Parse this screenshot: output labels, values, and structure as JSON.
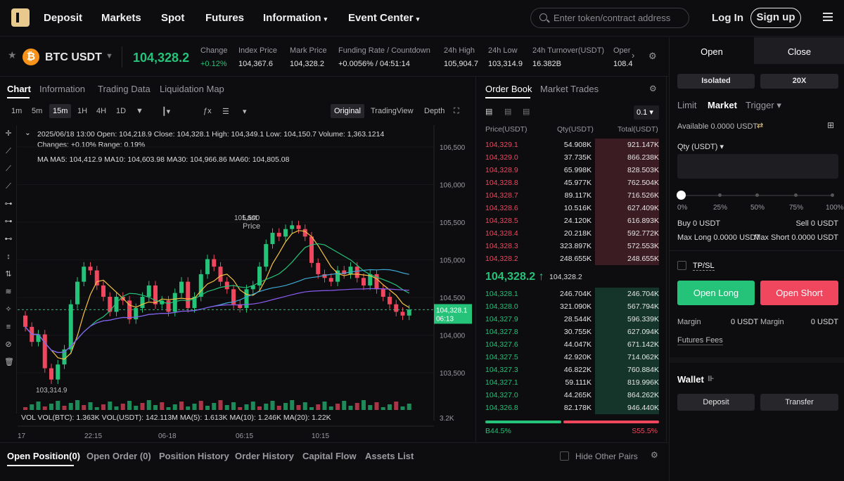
{
  "nav": {
    "items": [
      "Deposit",
      "Markets",
      "Spot",
      "Futures",
      "Information",
      "Event Center"
    ],
    "search_placeholder": "Enter token/contract address",
    "login": "Log In",
    "signup": "Sign up"
  },
  "ticker": {
    "pair": "BTC USDT",
    "last_price": "104,328.2",
    "stats": [
      {
        "label": "Change",
        "value": "+0.12%"
      },
      {
        "label": "Index Price",
        "value": "104,367.6"
      },
      {
        "label": "Mark Price",
        "value": "104,328.2"
      },
      {
        "label": "Funding Rate / Countdown",
        "value": "+0.0056% / 04:51:14"
      },
      {
        "label": "24h High",
        "value": "105,904.7"
      },
      {
        "label": "24h Low",
        "value": "103,314.9"
      },
      {
        "label": "24h Turnover(USDT)",
        "value": "16.382B"
      },
      {
        "label": "Oper",
        "value": "108.4"
      }
    ]
  },
  "chart_tabs": [
    "Chart",
    "Information",
    "Trading Data",
    "Liquidation Map"
  ],
  "chart_toolbar": {
    "intervals": [
      "1m",
      "5m",
      "15m",
      "1H",
      "4H",
      "1D"
    ],
    "price_type": "Last Price",
    "views": [
      "Original",
      "TradingView",
      "Depth"
    ]
  },
  "candle_info": {
    "line1": "2025/06/18 13:00  Open: 104,218.9  Close: 104,328.1  High: 104,349.1  Low: 104,150.7  Volume: 1,363.1214",
    "line2": "Changes: +0.10%  Range: 0.19%",
    "ma_line": "MA  MA5: 104,412.9  MA10: 104,603.98  MA30: 104,966.86  MA60: 104,805.08",
    "vol_line": "VOL  VOL(BTC): 1.363K  VOL(USDT): 142.113M  MA(5): 1.613K  MA(10): 1.246K  MA(20): 1.22K"
  },
  "chart_data": {
    "type": "line",
    "y_ticks": [
      "106,500",
      "106,000",
      "105,500",
      "105,000",
      "104,500",
      "104,000",
      "103,500"
    ],
    "x_ticks": [
      "17",
      "22:15",
      "06-18",
      "06:15",
      "10:15"
    ],
    "annotations": {
      "high": "105,500",
      "low": "103,314.9",
      "current": "104,328.1",
      "countdown": "06:13",
      "vol_axis": "3.2K"
    },
    "close": [
      104100,
      103900,
      104000,
      103550,
      103400,
      103600,
      103800,
      104400,
      104700,
      104900,
      104850,
      104650,
      104500,
      104300,
      104500,
      104450,
      104200,
      104350,
      104500,
      104650,
      104400,
      104450,
      104300,
      104550,
      104700,
      104350,
      104500,
      104800,
      105000,
      104900,
      104700,
      104600,
      104400,
      104350,
      104600,
      104650,
      104900,
      105200,
      105350,
      105300,
      105400,
      105450,
      105400,
      105300,
      104950,
      104800,
      104750,
      104700,
      104850,
      104800,
      104900,
      104750,
      104650,
      104800,
      104600,
      104500,
      104400,
      104300,
      104250,
      104330
    ]
  },
  "orderbook": {
    "tabs": [
      "Order Book",
      "Market Trades"
    ],
    "precision": "0.1",
    "headers": [
      "Price(USDT)",
      "Qty(USDT)",
      "Total(USDT)"
    ],
    "asks": [
      [
        "104,329.1",
        "54.908K",
        "921.147K"
      ],
      [
        "104,329.0",
        "37.735K",
        "866.238K"
      ],
      [
        "104,328.9",
        "65.998K",
        "828.503K"
      ],
      [
        "104,328.8",
        "45.977K",
        "762.504K"
      ],
      [
        "104,328.7",
        "89.117K",
        "716.526K"
      ],
      [
        "104,328.6",
        "10.516K",
        "627.409K"
      ],
      [
        "104,328.5",
        "24.120K",
        "616.893K"
      ],
      [
        "104,328.4",
        "20.218K",
        "592.772K"
      ],
      [
        "104,328.3",
        "323.897K",
        "572.553K"
      ],
      [
        "104,328.2",
        "248.655K",
        "248.655K"
      ]
    ],
    "mid_price": "104,328.2",
    "mid_mark": "104,328.2",
    "bids": [
      [
        "104,328.1",
        "246.704K",
        "246.704K"
      ],
      [
        "104,328.0",
        "321.090K",
        "567.794K"
      ],
      [
        "104,327.9",
        "28.544K",
        "596.339K"
      ],
      [
        "104,327.8",
        "30.755K",
        "627.094K"
      ],
      [
        "104,327.6",
        "44.047K",
        "671.142K"
      ],
      [
        "104,327.5",
        "42.920K",
        "714.062K"
      ],
      [
        "104,327.3",
        "46.822K",
        "760.884K"
      ],
      [
        "104,327.1",
        "59.111K",
        "819.996K"
      ],
      [
        "104,327.0",
        "44.265K",
        "864.262K"
      ],
      [
        "104,326.8",
        "82.178K",
        "946.440K"
      ]
    ],
    "buy_pct": "B44.5%",
    "sell_pct": "S55.5%"
  },
  "order_panel": {
    "tabs": [
      "Open",
      "Close"
    ],
    "margin_mode": "Isolated",
    "leverage": "20X",
    "types": [
      "Limit",
      "Market",
      "Trigger"
    ],
    "available": "Available 0.0000 USDT",
    "qty_label": "Qty (USDT)",
    "slider_marks": [
      "0%",
      "25%",
      "50%",
      "75%",
      "100%"
    ],
    "buy": "Buy 0 USDT",
    "sell": "Sell 0 USDT",
    "max_long": "Max Long 0.0000 USDT",
    "max_short": "Max Short 0.0000 USDT",
    "tpsl": "TP/SL",
    "open_long": "Open Long",
    "open_short": "Open Short",
    "margin_label": "Margin",
    "margin_value": "0 USDT",
    "fees": "Futures Fees",
    "wallet": "Wallet",
    "deposit": "Deposit",
    "transfer": "Transfer"
  },
  "bottom_tabs": [
    "Open Position(0)",
    "Open Order (0)",
    "Position History",
    "Order History",
    "Capital Flow",
    "Assets List"
  ],
  "hide_pairs": "Hide Other Pairs"
}
